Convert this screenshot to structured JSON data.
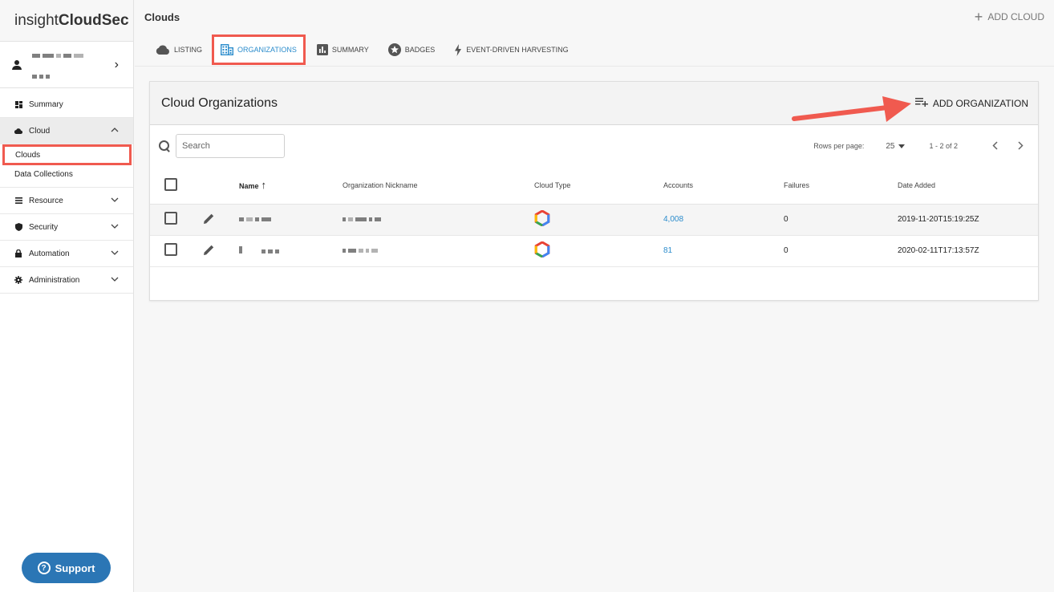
{
  "app": {
    "logo_light": "insight",
    "logo_bold": "CloudSec"
  },
  "sidebar": {
    "items": [
      {
        "label": "Summary",
        "icon": "dashboard-icon"
      },
      {
        "label": "Cloud",
        "icon": "cloud-icon",
        "expanded": true
      },
      {
        "label": "Resource",
        "icon": "list-icon"
      },
      {
        "label": "Security",
        "icon": "shield-icon"
      },
      {
        "label": "Automation",
        "icon": "lock-icon"
      },
      {
        "label": "Administration",
        "icon": "gear-icon"
      }
    ],
    "cloud_children": [
      {
        "label": "Clouds",
        "active": true
      },
      {
        "label": "Data Collections"
      }
    ],
    "support_label": "Support"
  },
  "header": {
    "title": "Clouds",
    "add_cloud_label": "ADD CLOUD"
  },
  "tabs": [
    {
      "label": "LISTING",
      "icon": "cloud-icon"
    },
    {
      "label": "ORGANIZATIONS",
      "icon": "building-icon",
      "active": true
    },
    {
      "label": "SUMMARY",
      "icon": "bar-chart-icon"
    },
    {
      "label": "BADGES",
      "icon": "star-badge-icon"
    },
    {
      "label": "EVENT-DRIVEN HARVESTING",
      "icon": "lightning-icon"
    }
  ],
  "card": {
    "title": "Cloud Organizations",
    "add_org_label": "ADD ORGANIZATION",
    "search_placeholder": "Search",
    "rows_per_page_label": "Rows per page:",
    "rows_per_page_value": "25",
    "range_label": "1 - 2 of 2"
  },
  "table": {
    "columns": [
      "Name",
      "Organization Nickname",
      "Cloud Type",
      "Accounts",
      "Failures",
      "Date Added"
    ],
    "rows": [
      {
        "accounts": "4,008",
        "failures": "0",
        "date_added": "2019-11-20T15:19:25Z"
      },
      {
        "accounts": "81",
        "failures": "0",
        "date_added": "2020-02-11T17:13:57Z"
      }
    ]
  },
  "colors": {
    "accent": "#2b8ccc",
    "highlight": "#f05a4f",
    "support": "#2b76b5"
  }
}
